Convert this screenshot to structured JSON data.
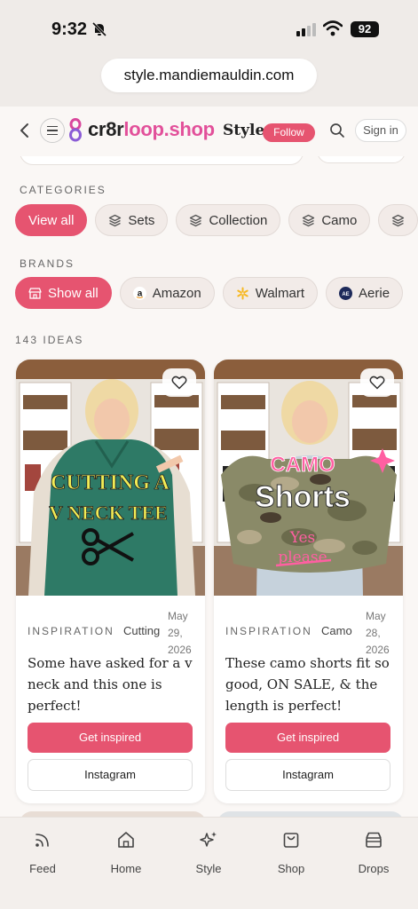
{
  "status": {
    "time": "9:32",
    "battery": "92"
  },
  "browser": {
    "url": "style.mandiemauldin.com"
  },
  "header": {
    "logo_part1": "cr8r",
    "logo_part2": "loop.shop",
    "style_label": "Style",
    "follow_label": "Follow",
    "signin_label": "Sign in"
  },
  "categories": {
    "label": "CATEGORIES",
    "items": [
      {
        "label": "View all"
      },
      {
        "label": "Sets"
      },
      {
        "label": "Collection"
      },
      {
        "label": "Camo"
      }
    ]
  },
  "brands": {
    "label": "BRANDS",
    "items": [
      {
        "label": "Show all"
      },
      {
        "label": "Amazon"
      },
      {
        "label": "Walmart"
      },
      {
        "label": "Aerie"
      }
    ]
  },
  "ideas_count": "143 IDEAS",
  "cards": [
    {
      "kind": "INSPIRATION",
      "tag": "Cutting",
      "date_line1": "May",
      "date_line2": "29,",
      "date_line3": "2026",
      "caption": "Some have asked for a v neck and this one is perfect!",
      "image_text1": "CUTTING A",
      "image_text2": "V NECK TEE",
      "primary_label": "Get inspired",
      "secondary_label": "Instagram"
    },
    {
      "kind": "INSPIRATION",
      "tag": "Camo",
      "date_line1": "May",
      "date_line2": "28,",
      "date_line3": "2026",
      "caption": "These camo shorts fit so good, ON SALE, & the length is perfect!",
      "image_text1": "CAMO",
      "image_text2": "Shorts",
      "image_text3": "Yes",
      "image_text4": "please",
      "primary_label": "Get inspired",
      "secondary_label": "Instagram"
    }
  ],
  "nav": {
    "items": [
      {
        "label": "Feed",
        "icon": "feed-icon"
      },
      {
        "label": "Home",
        "icon": "home-icon"
      },
      {
        "label": "Style",
        "icon": "sparkle-icon"
      },
      {
        "label": "Shop",
        "icon": "shopping-bag-icon"
      },
      {
        "label": "Drops",
        "icon": "drops-box-icon"
      }
    ]
  },
  "colors": {
    "accent": "#e65470",
    "logo_pink": "#e2509a"
  }
}
